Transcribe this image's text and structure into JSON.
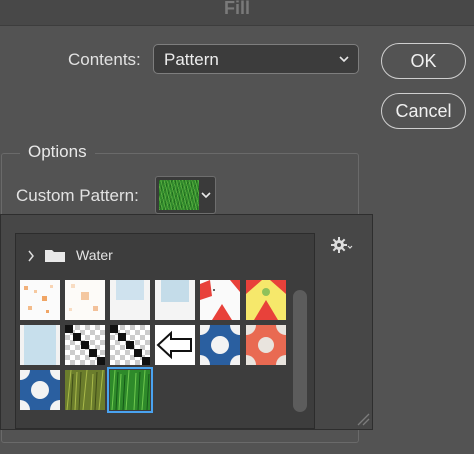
{
  "window": {
    "title": "Fill"
  },
  "contents": {
    "label": "Contents:",
    "value": "Pattern"
  },
  "buttons": {
    "ok": "OK",
    "cancel": "Cancel"
  },
  "options": {
    "legend": "Options",
    "custom_pattern_label": "Custom Pattern:"
  },
  "picker": {
    "folder_name": "Water",
    "patterns": [
      "water-pattern-1",
      "water-pattern-2",
      "water-pattern-3",
      "water-pattern-4",
      "water-pattern-5",
      "water-pattern-6",
      "water-pattern-7",
      "water-pattern-8",
      "water-pattern-9",
      "water-pattern-10",
      "water-pattern-11",
      "water-pattern-12",
      "water-pattern-13",
      "water-pattern-14",
      "water-pattern-15"
    ],
    "selected_pattern": "water-pattern-15"
  },
  "colors": {
    "accent_selection": "#4aa3f0",
    "dialog_bg": "#535353",
    "panel_bg": "#474747"
  }
}
